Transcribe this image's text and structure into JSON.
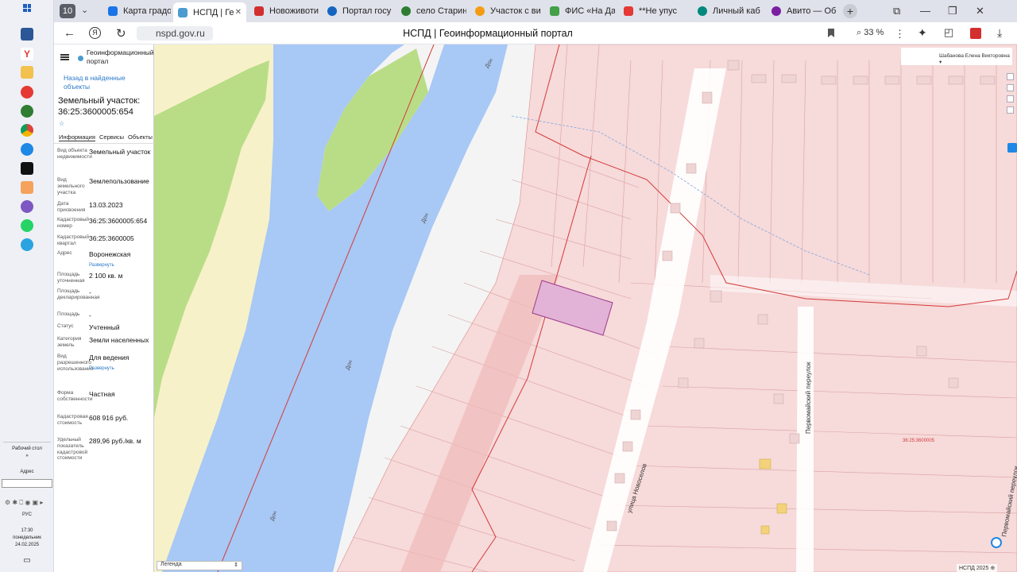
{
  "browser": {
    "tab_count": "10",
    "tabs": [
      {
        "label": "Карта градо",
        "color": "#1a73e8"
      },
      {
        "label": "НСПД | Ге",
        "color": "#4b9bd1",
        "active": true
      },
      {
        "label": "Новоживоти",
        "color": "#d32f2f"
      },
      {
        "label": "Портал госу",
        "color": "#1565c0"
      },
      {
        "label": "село Старин",
        "color": "#2e7d32"
      },
      {
        "label": "Участок с ви",
        "color": "#f39c12"
      },
      {
        "label": "ФИС «На Да",
        "color": "#43a047"
      },
      {
        "label": "**Не упус",
        "color": "#e53935"
      },
      {
        "label": "Личный каб",
        "color": "#00897b"
      },
      {
        "label": "Авито — Об",
        "color": "#7b1fa2"
      }
    ],
    "url": "nspd.gov.ru",
    "page_title": "НСПД | Геоинформационный портал",
    "zoom": "33 %"
  },
  "taskbar": {
    "desktop_label": "Рабочий стол",
    "address_label": "Адрес",
    "lang": "РУС",
    "time": "17:30",
    "weekday": "понедельник",
    "date": "24.02.2025"
  },
  "panel": {
    "brand": "Геоинформационный портал",
    "back_link": "Назад в найденные объекты",
    "title": "Земельный участок: 36:25:3600005:654",
    "tabs": [
      "Информация",
      "Сервисы",
      "Объекты"
    ],
    "fields": [
      {
        "label": "Вид объекта недвижимости",
        "value": "Земельный участок"
      },
      {
        "label": "Вид земельного участка",
        "value": "Землепользование"
      },
      {
        "label": "Дата присвоения",
        "value": "13.03.2023"
      },
      {
        "label": "Кадастровый номер",
        "value": "36:25:3600005:654"
      },
      {
        "label": "Кадастровый квартал",
        "value": "36:25:3600005"
      },
      {
        "label": "Адрес",
        "value": "Воронежская область",
        "link": "Развернуть"
      },
      {
        "label": "Площадь уточненная",
        "value": "2 100 кв. м"
      },
      {
        "label": "Площадь декларированная",
        "value": "-"
      },
      {
        "label": "Площадь",
        "value": "-"
      },
      {
        "label": "Статус",
        "value": "Учтенный"
      },
      {
        "label": "Категория земель",
        "value": "Земли населенных пунктов"
      },
      {
        "label": "Вид разрешенного использования",
        "value": "Для ведения личного",
        "link": "Развернуть"
      },
      {
        "label": "Форма собственности",
        "value": "Частная"
      },
      {
        "label": "Кадастровая стоимость",
        "value": "608 916 руб."
      },
      {
        "label": "Удельный показатель кадастровой стоимости",
        "value": "289,96 руб./кв. м"
      }
    ]
  },
  "map": {
    "owner": "Шабанова Елена Викторовна",
    "legend": "Легенда",
    "credits": "НСПД 2025",
    "river_label": "Дон",
    "street1": "улица Новоселов",
    "street2": "Первомайский переулок",
    "street3": "Первомайский переулок",
    "quarter": "36:25:3600005",
    "colors": {
      "river": "#a8c8f5",
      "parcel": "#f7dada",
      "selected": "#e2b3d6",
      "border": "#d33a3a"
    }
  }
}
